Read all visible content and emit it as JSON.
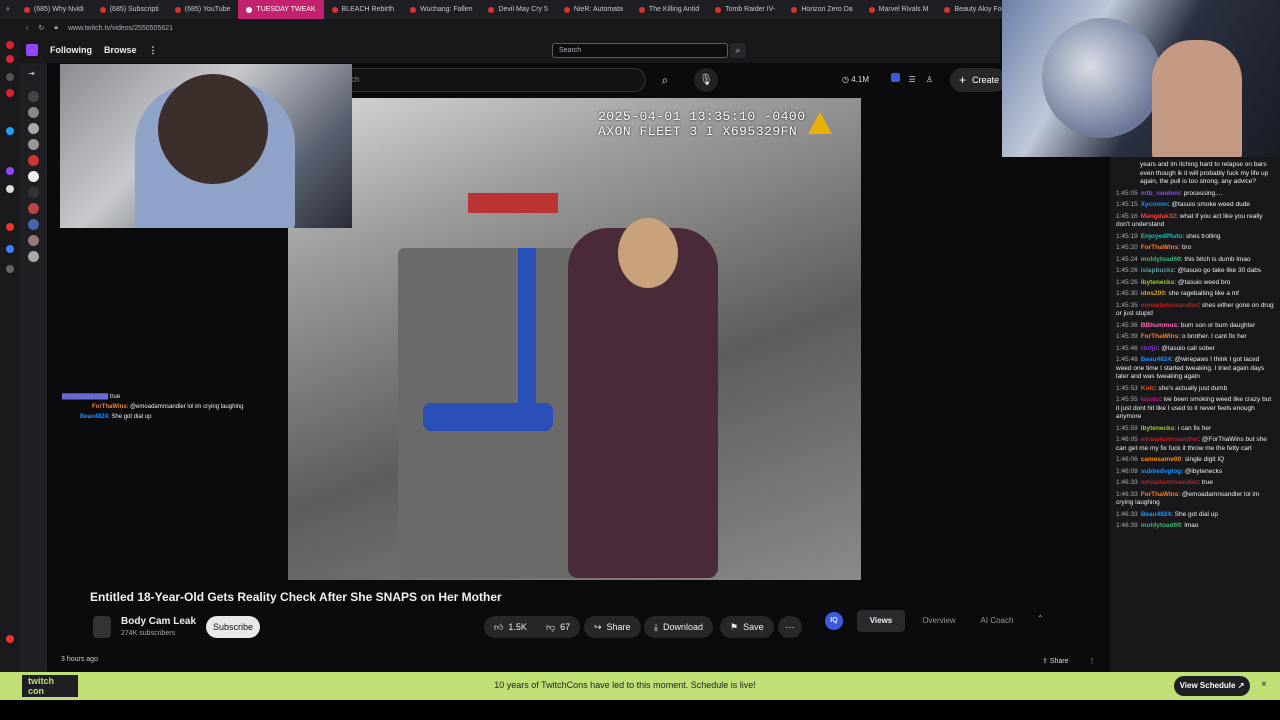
{
  "browser": {
    "tabs": [
      {
        "label": "(685) Why Nvidi"
      },
      {
        "label": "(685) Subscripti"
      },
      {
        "label": "(685) YouTube"
      },
      {
        "label": "TUESDAY TWEAK",
        "active": true
      },
      {
        "label": "BLEACH Rebirth"
      },
      {
        "label": "Wuchang: Fallen"
      },
      {
        "label": "Devil May Cry 5"
      },
      {
        "label": "NieR: Automata"
      },
      {
        "label": "The Killing Antid"
      },
      {
        "label": "Tomb Raider IV-"
      },
      {
        "label": "Horizon Zero Da"
      },
      {
        "label": "Marvel Rivals M"
      },
      {
        "label": "Beauty Aloy Foc"
      }
    ],
    "url": "www.twitch.tv/videos/2550505621"
  },
  "twitch_nav": {
    "following": "Following",
    "browse": "Browse",
    "search_placeholder": "Search"
  },
  "youtube": {
    "search_partial": "ch",
    "views_badge": "4.1M",
    "create_label": "Create",
    "video_timestamp": "2025-04-01 13:35:10 -0400",
    "video_device": "AXON FLEET 3 I X695329FN",
    "title": "Entitled 18-Year-Old Gets Reality Check After She SNAPS on Her Mother",
    "channel": {
      "name": "Body Cam Leak",
      "subscribers": "274K subscribers",
      "subscribe_label": "Subscribe"
    },
    "actions": {
      "likes": "1.5K",
      "dislikes": "67",
      "share": "Share",
      "download": "Download",
      "save": "Save"
    },
    "tool_tabs": {
      "badge": "IQ",
      "views": "Views",
      "overview": "Overview",
      "ai_coach": "AI Coach"
    },
    "posted": "3 hours ago",
    "share_bottom": "Share"
  },
  "overlay_chat": [
    {
      "user": "",
      "text": "true"
    },
    {
      "user": "ForThaWins",
      "text": "@emoadamnsandler lol im crying laughing"
    },
    {
      "user": "Beau4824",
      "text": "She got dial up"
    }
  ],
  "chat": {
    "header_text": "years and im itching hard to relapse on bars even though ik it will probably fuck my life up again, the pull is too strong. any advice?",
    "messages": [
      {
        "time": "1:45:05",
        "user": "mtb_random",
        "text": "processing....",
        "color": "#9147ff"
      },
      {
        "time": "1:45:15",
        "user": "Xycomm",
        "text": "@tasuio smoke weed dude",
        "color": "#1e90ff"
      },
      {
        "time": "1:45:16",
        "user": "Mangdak32",
        "text": "what if you act like you really don't understand",
        "color": "#ff3c3c"
      },
      {
        "time": "1:45:19",
        "user": "EnjoyedPluto",
        "text": "shes trolling",
        "color": "#00c8c8"
      },
      {
        "time": "1:45:20",
        "user": "ForThaWins",
        "text": "bro",
        "color": "#ff7f27"
      },
      {
        "time": "1:45:24",
        "user": "moldytoad69",
        "text": "this bitch is dumb lmao",
        "color": "#3cb371"
      },
      {
        "time": "1:45:26",
        "user": "islapbuckz",
        "text": "@tasuio go take like 30 dabs",
        "color": "#5f9ea0"
      },
      {
        "time": "1:45:26",
        "user": "ibytenecks",
        "text": "@tasuio weed bro",
        "color": "#9acd32"
      },
      {
        "time": "1:45:30",
        "user": "idos200",
        "text": "she ragebaiting like a mf",
        "color": "#daa520"
      },
      {
        "time": "1:45:35",
        "user": "emoadamnsandler",
        "text": "shes either gone on drug or just stupid",
        "color": "#b22222"
      },
      {
        "time": "1:45:36",
        "user": "BBhummus",
        "text": "bum son or bum daughter",
        "color": "#ff69b4"
      },
      {
        "time": "1:45:39",
        "user": "ForThaWins",
        "text": "o brother. I cant fix her",
        "color": "#ff7f27"
      },
      {
        "time": "1:45:46",
        "user": "rbrtjn",
        "text": "@tasuio call sober",
        "color": "#8a2be2"
      },
      {
        "time": "1:45:48",
        "user": "Beau4824",
        "text": "@wirepaws I think I got laced weed one time I started tweaking. I tried again days later and was tweaking again",
        "color": "#1e90ff"
      },
      {
        "time": "1:45:53",
        "user": "Kolc",
        "text": "she's actually just dumb",
        "color": "#ff4500"
      },
      {
        "time": "1:45:55",
        "user": "taisdu",
        "text": "ive been smoking weed like crazy but it just dont hit like I used to it never feels enough anymore",
        "color": "#c71585"
      },
      {
        "time": "1:45:59",
        "user": "ibytenecks",
        "text": "i can fix her",
        "color": "#9acd32"
      },
      {
        "time": "1:46:05",
        "user": "emoadamnsandler",
        "text": "@ForThaWins but she can get me my fix fuck it throw me the fetty cart",
        "color": "#b22222"
      },
      {
        "time": "1:46:06",
        "user": "camesame00",
        "text": "single digit IQ",
        "color": "#ff8c00"
      },
      {
        "time": "1:46:08",
        "user": "subbedvglog",
        "text": "@ibytenecks",
        "color": "#1e90ff"
      },
      {
        "time": "1:46:33",
        "user": "emoadamnsandler",
        "text": "true",
        "color": "#b22222"
      },
      {
        "time": "1:46:33",
        "user": "ForThaWins",
        "text": "@emoadamnsandler lol im crying laughing",
        "color": "#ff7f27"
      },
      {
        "time": "1:46:33",
        "user": "Beau4824",
        "text": "She got dial up",
        "color": "#1e90ff"
      },
      {
        "time": "1:46:39",
        "user": "moldytoad69",
        "text": "lmao",
        "color": "#3cb371"
      }
    ]
  },
  "banner": {
    "logo": "twitch con",
    "text": "10 years of TwitchCons have led to this moment. Schedule is live!",
    "cta": "View Schedule ↗"
  },
  "colors": {
    "twitch_purple": "#9147ff",
    "banner_green": "#bfe074",
    "active_tab": "#c4226e"
  }
}
